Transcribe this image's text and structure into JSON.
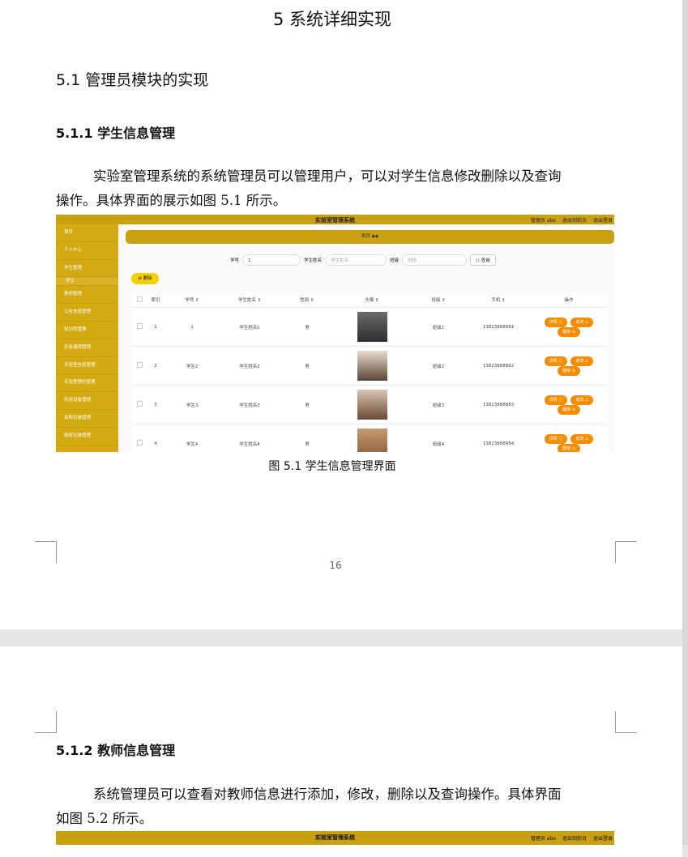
{
  "page1": {
    "chapter_title": "5 系统详细实现",
    "section_title": "5.1  管理员模块的实现",
    "subsection_title": "5.1.1  学生信息管理",
    "para_line1": "实验室管理系统的系统管理员可以管理用户，可以对学生信息修改删除以及查询",
    "para_line2": "操作。具体界面的展示如图 5.1 所示。",
    "caption": "图 5.1  学生信息管理界面",
    "page_number": "16"
  },
  "screenshot": {
    "app_title": "实验室管理系统",
    "top_links": [
      "管理员 abo",
      "退出到前台",
      "退出登录"
    ],
    "sidebar": [
      "首页",
      "个人中心",
      "学生管理",
      "学生",
      "教师管理",
      "公告信息管理",
      "知识库管理",
      "实验课程管理",
      "实验室信息管理",
      "实验室预约管理",
      "实验设备管理",
      "采购记录管理",
      "维修记录管理"
    ],
    "banner": "首页  ◆◆",
    "search": {
      "label_id": "学号",
      "value_id": "1",
      "label_name": "学生姓名",
      "placeholder_name": "学生姓名",
      "label_class": "班级",
      "placeholder_class": "班级",
      "button": "○ 查询"
    },
    "delete_button": "⊖ 删除",
    "columns": [
      "",
      "索引",
      "学号 ⇕",
      "学生姓名 ⇕",
      "性别 ⇕",
      "头像 ⇕",
      "班级 ⇕",
      "手机 ⇕",
      "操作"
    ],
    "rows": [
      {
        "idx": "1",
        "sid": "1",
        "name": "学生姓名1",
        "sex": "男",
        "cls": "班级1",
        "phone": "13823888881"
      },
      {
        "idx": "2",
        "sid": "学生2",
        "name": "学生姓名2",
        "sex": "男",
        "cls": "班级2",
        "phone": "13823888882"
      },
      {
        "idx": "3",
        "sid": "学生3",
        "name": "学生姓名3",
        "sex": "男",
        "cls": "班级3",
        "phone": "13823888883"
      },
      {
        "idx": "4",
        "sid": "学生4",
        "name": "学生姓名4",
        "sex": "男",
        "cls": "班级4",
        "phone": "13823888884"
      }
    ],
    "actions": [
      "详情 ⓘ",
      "修改 ∠",
      "删除 ⊙"
    ],
    "colors": {
      "accent": "#c9a012",
      "sidebar": "#d4aa12",
      "action": "#f58c00",
      "delete": "#f5d000"
    }
  },
  "page2": {
    "subsection_title": "5.1.2  教师信息管理",
    "para_line1": "系统管理员可以查看对教师信息进行添加，修改，删除以及查询操作。具体界面",
    "para_line2": "如图 5.2 所示。",
    "app_title": "实验室管理系统",
    "top_links": [
      "管理员 abo",
      "退出到前台",
      "退出登录"
    ]
  }
}
